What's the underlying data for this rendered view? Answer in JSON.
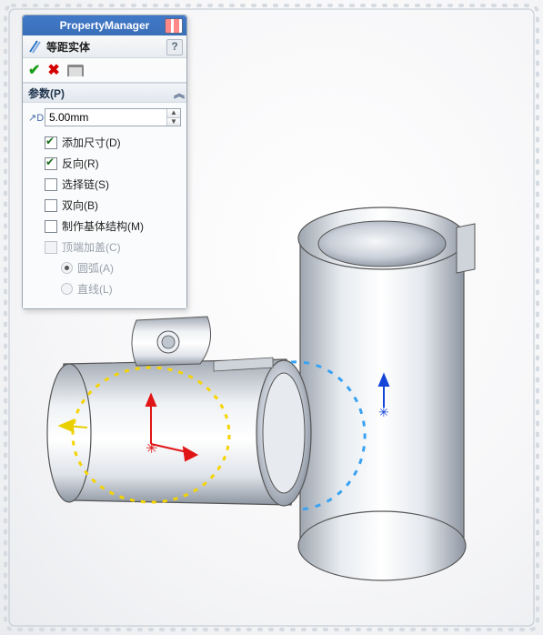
{
  "title": "PropertyManager",
  "feature": {
    "name": "等距实体",
    "help": "?"
  },
  "buttons": {
    "ok_glyph": "✔",
    "cancel_glyph": "✖"
  },
  "section": {
    "header": "参数(P)",
    "distance_label": "↗D",
    "distance_value": "5.00mm",
    "spinner_up": "▲",
    "spinner_down": "▼",
    "chevrons": "︽"
  },
  "options": {
    "add_dim": {
      "label": "添加尺寸(D)",
      "checked": true,
      "enabled": true
    },
    "reverse": {
      "label": "反向(R)",
      "checked": true,
      "enabled": true
    },
    "sel_chain": {
      "label": "选择链(S)",
      "checked": false,
      "enabled": true
    },
    "bi_dir": {
      "label": "双向(B)",
      "checked": false,
      "enabled": true
    },
    "base_con": {
      "label": "制作基体结构(M)",
      "checked": false,
      "enabled": true
    },
    "cap_ends": {
      "label": "顶端加盖(C)",
      "checked": false,
      "enabled": false
    },
    "arc": {
      "label": "圆弧(A)",
      "selected": true,
      "enabled": false
    },
    "line": {
      "label": "直线(L)",
      "selected": false,
      "enabled": false
    }
  }
}
